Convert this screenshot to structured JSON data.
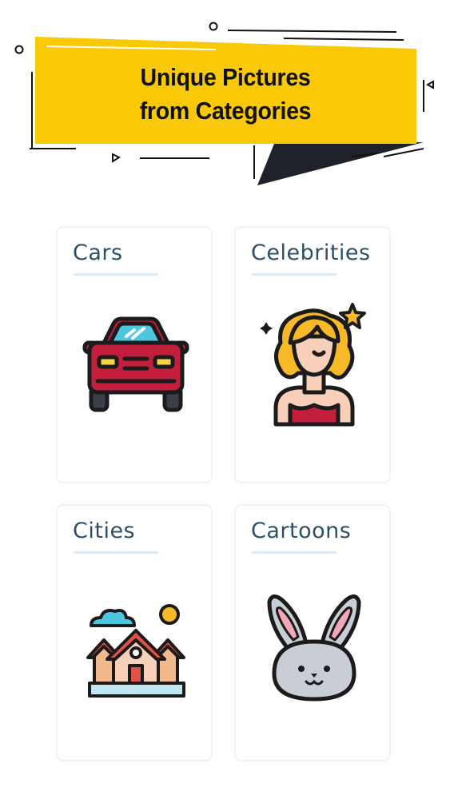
{
  "banner": {
    "title_line1": "Unique Pictures",
    "title_line2": "from Categories",
    "background_color": "#F9C806"
  },
  "categories": [
    {
      "label": "Cars",
      "icon": "car-icon"
    },
    {
      "label": "Celebrities",
      "icon": "woman-celebrity-icon"
    },
    {
      "label": "Cities",
      "icon": "houses-icon"
    },
    {
      "label": "Cartoons",
      "icon": "bunny-icon"
    }
  ],
  "colors": {
    "title_text": "#2D5067",
    "underline": "#D6ECF8",
    "card_border": "#EEF3F8"
  }
}
